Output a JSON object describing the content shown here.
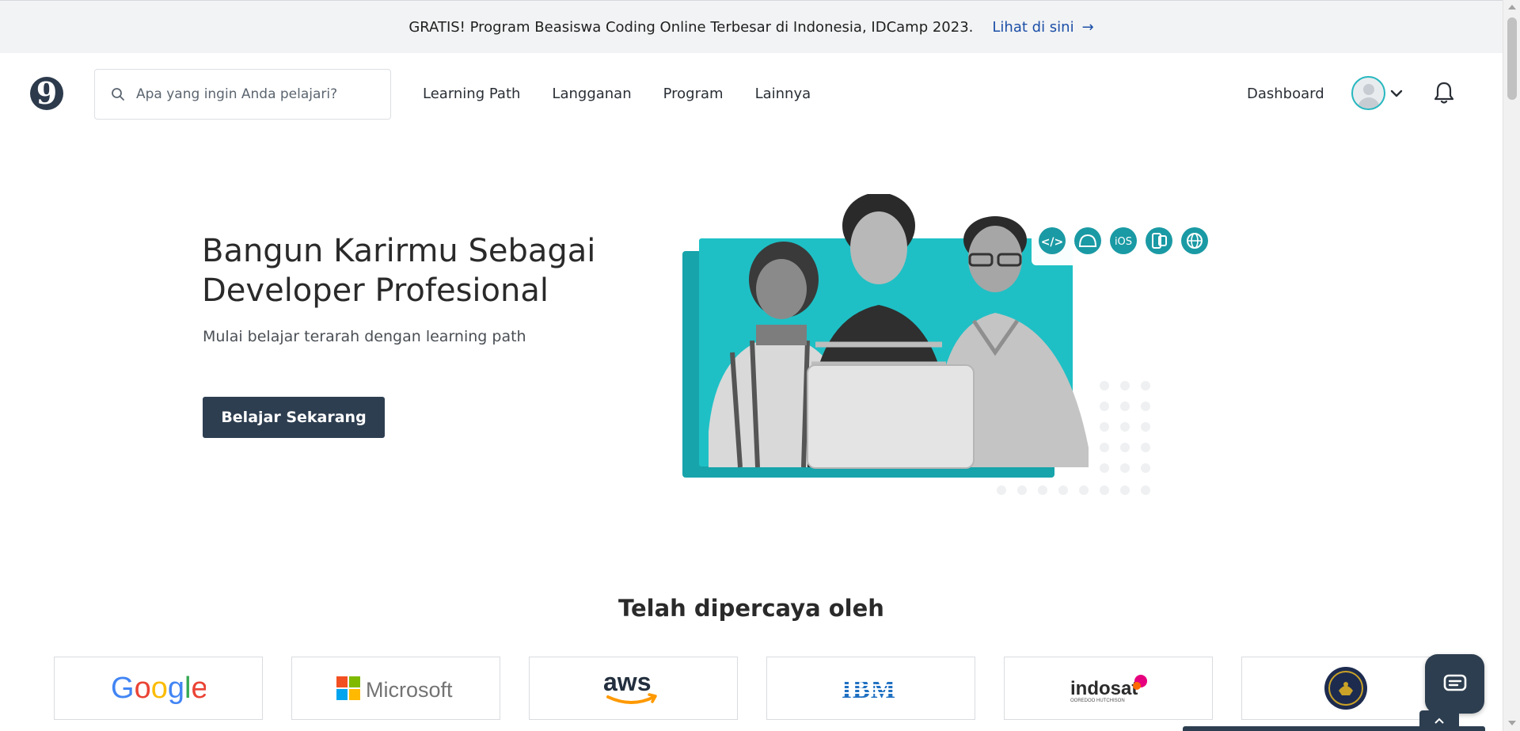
{
  "announcement": {
    "message": "GRATIS! Program Beasiswa Coding Online Terbesar di Indonesia, IDCamp 2023.",
    "link_label": "Lihat di sini",
    "link_arrow": "→"
  },
  "header": {
    "logo_glyph": "9",
    "search_placeholder": "Apa yang ingin Anda pelajari?",
    "nav": [
      "Learning Path",
      "Langganan",
      "Program",
      "Lainnya"
    ],
    "dashboard_label": "Dashboard"
  },
  "hero": {
    "title": "Bangun Karirmu Sebagai Developer Profesional",
    "subtitle": "Mulai belajar terarah dengan learning path",
    "cta_label": "Belajar Sekarang",
    "platform_badges": [
      "code-icon",
      "android-icon",
      "iOS",
      "multiplatform-icon",
      "web-icon"
    ]
  },
  "trusted": {
    "title": "Telah dipercaya oleh",
    "partners": [
      "Google",
      "Microsoft",
      "aws",
      "IBM",
      "indosat",
      "Kemenkominfo seal"
    ],
    "indosat_tagline": "OOREDOO HUTCHISON"
  },
  "colors": {
    "brand_dark": "#2d3e50",
    "accent_teal": "#1ec0c5",
    "teal_dark": "#17a4ab",
    "link_blue": "#1c4fa8"
  }
}
